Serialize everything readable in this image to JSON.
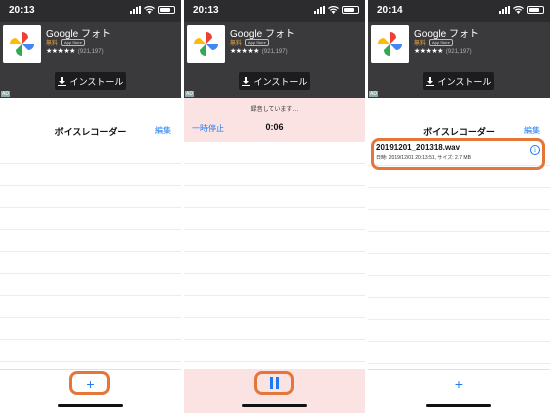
{
  "status_times": [
    "20:13",
    "20:13",
    "20:14"
  ],
  "ad": {
    "app_name": "Google フォト",
    "price": "無料",
    "store_badge": "App Store",
    "stars": "★★★★★",
    "rating_count": "(921,197)",
    "install_label": "インストール",
    "ad_choice": "AD"
  },
  "nav": {
    "title": "ボイスレコーダー",
    "edit_label": "編集"
  },
  "recording": {
    "status_text": "録音しています…",
    "pause_label": "一時停止",
    "elapsed": "0:06"
  },
  "file": {
    "name": "20191201_201318.wav",
    "meta": "日時: 2019/12/01 20:13:51, サイズ: 2.7 MB"
  },
  "toolbar": {
    "add_symbol": "+"
  },
  "colors": {
    "accent": "#1a7cf5",
    "highlight": "#e4763a",
    "recording_bg": "#fbe3e3",
    "status_bar": "#2c2c2e"
  }
}
